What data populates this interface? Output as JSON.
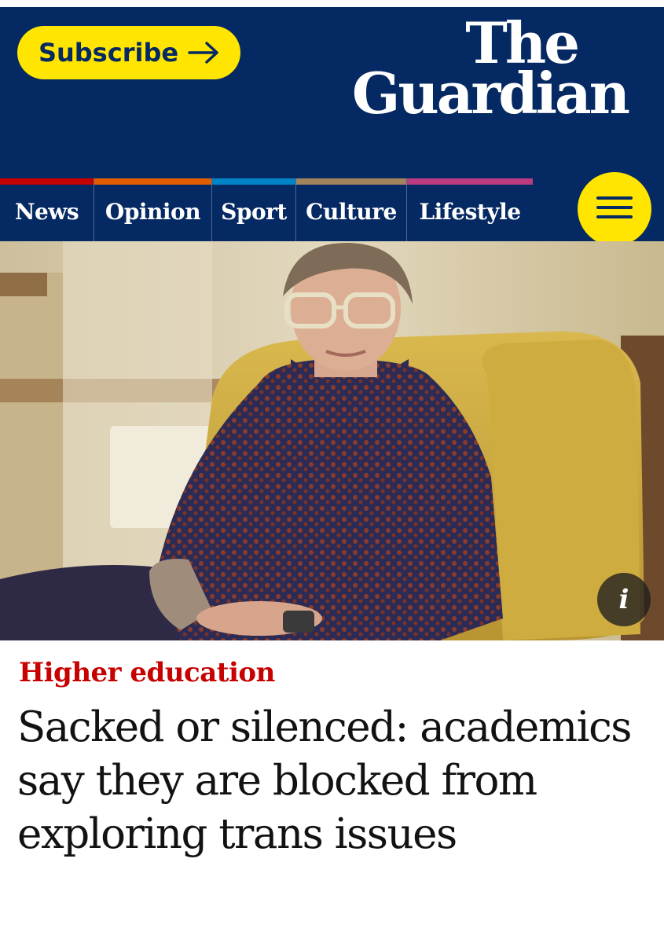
{
  "header": {
    "subscribe_label": "Subscribe",
    "logo_line1": "The",
    "logo_line2": "Guardian",
    "background": "#052962",
    "accent_yellow": "#ffe500"
  },
  "nav": {
    "items": [
      {
        "label": "News",
        "color": "#c70000"
      },
      {
        "label": "Opinion",
        "color": "#e05e00"
      },
      {
        "label": "Sport",
        "color": "#0084c6"
      },
      {
        "label": "Culture",
        "color": "#a1845c"
      },
      {
        "label": "Lifestyle",
        "color": "#bb3b80"
      }
    ],
    "menu_icon": "hamburger-icon"
  },
  "hero": {
    "info_icon": "info-icon",
    "info_glyph": "i"
  },
  "article": {
    "kicker": "Higher education",
    "kicker_color": "#c70000",
    "headline": "Sacked or silenced: academics say they are blocked from exploring trans issues"
  }
}
